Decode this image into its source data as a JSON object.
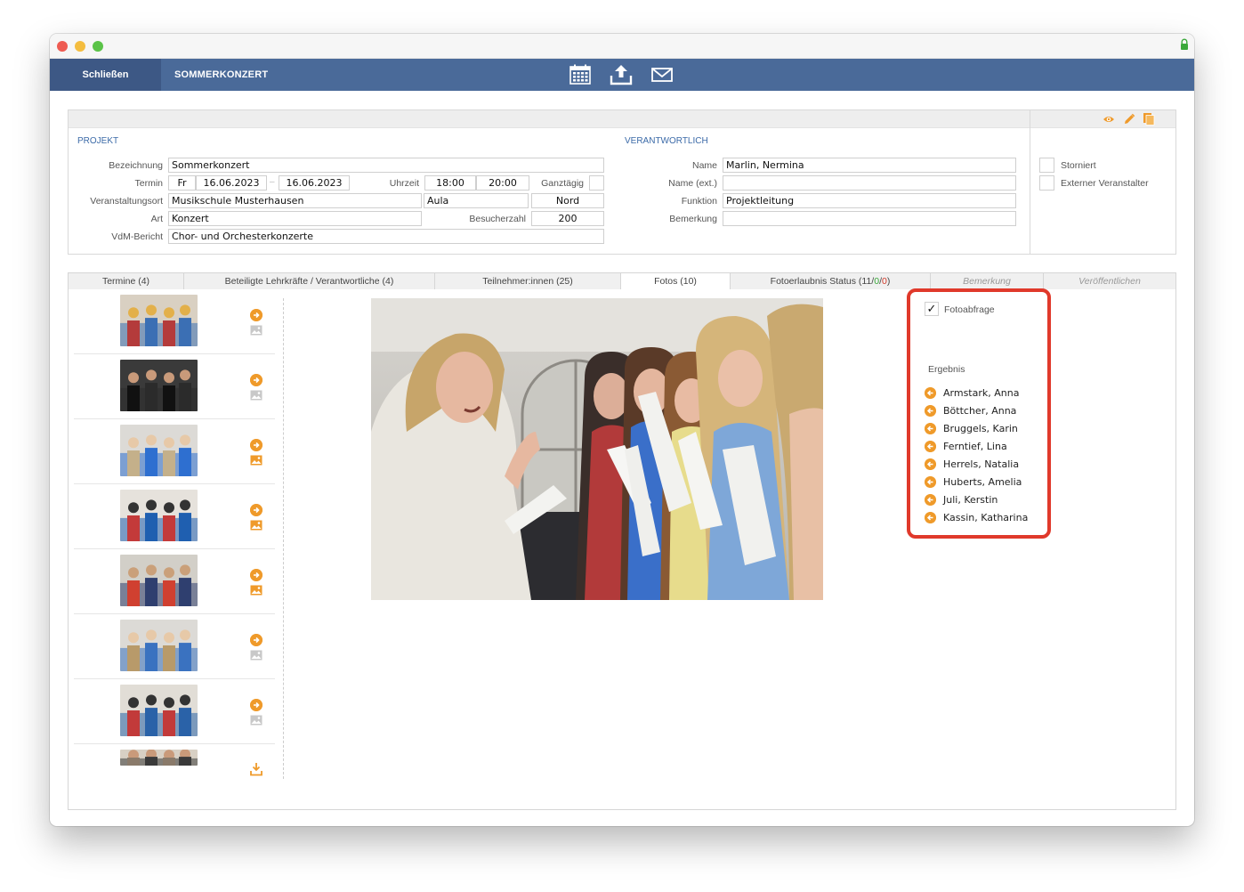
{
  "toolbar": {
    "close_label": "Schließen",
    "title": "SOMMERKONZERT",
    "icons": [
      "calendar-icon",
      "upload-icon",
      "mail-icon"
    ]
  },
  "header_icons": [
    "eye-icon",
    "pencil-icon",
    "copy-icon"
  ],
  "projekt": {
    "title": "PROJEKT",
    "bezeichnung_label": "Bezeichnung",
    "bezeichnung": "Sommerkonzert",
    "termin_label": "Termin",
    "weekday": "Fr",
    "date_from": "16.06.2023",
    "date_to": "16.06.2023",
    "date_sep": "–",
    "uhrzeit_label": "Uhrzeit",
    "time_from": "18:00",
    "time_to": "20:00",
    "ganztaegig_label": "Ganztägig",
    "ort_label": "Veranstaltungsort",
    "ort": "Musikschule Musterhausen",
    "raum": "Aula",
    "bereich": "Nord",
    "art_label": "Art",
    "art": "Konzert",
    "besucher_label": "Besucherzahl",
    "besucher": "200",
    "vdm_label": "VdM-Bericht",
    "vdm": "Chor- und Orchesterkonzerte"
  },
  "verantwortlich": {
    "title": "VERANTWORTLICH",
    "name_label": "Name",
    "name": "Marlin, Nermina",
    "name_ext_label": "Name (ext.)",
    "name_ext": "",
    "funktion_label": "Funktion",
    "funktion": "Projektleitung",
    "bemerkung_label": "Bemerkung",
    "bemerkung": ""
  },
  "flags": {
    "storniert_label": "Storniert",
    "extern_label": "Externer Veranstalter"
  },
  "tabs": [
    {
      "label": "Termine (4)"
    },
    {
      "label": "Beteiligte Lehrkräfte / Verantwortliche (4)"
    },
    {
      "label": "Teilnehmer:innen (25)"
    },
    {
      "label": "Fotos (10)"
    },
    {
      "label_prefix": "Fotoerlaubnis Status (11/",
      "green": "0",
      "slash": "/",
      "red": "0",
      "suffix": ")"
    },
    {
      "label": "Bemerkung"
    },
    {
      "label": "Veröffentlichen"
    }
  ],
  "colors": {
    "accent": "#ef9a2a",
    "toolbar": "#4a6a99",
    "highlight": "#e0392b",
    "green": "#3aa83a",
    "red": "#d23a2a"
  },
  "photos": {
    "fotoabfrage_label": "Fotoabfrage",
    "fotoabfrage_checked": true,
    "fotoabfrage_mark": "✓",
    "ergebnis_label": "Ergebnis",
    "participants": [
      "Armstark, Anna",
      "Böttcher, Anna",
      "Bruggels, Karin",
      "Ferntief, Lina",
      "Herrels, Natalia",
      "Huberts, Amelia",
      "Juli, Kerstin",
      "Kassin, Katharina"
    ]
  }
}
